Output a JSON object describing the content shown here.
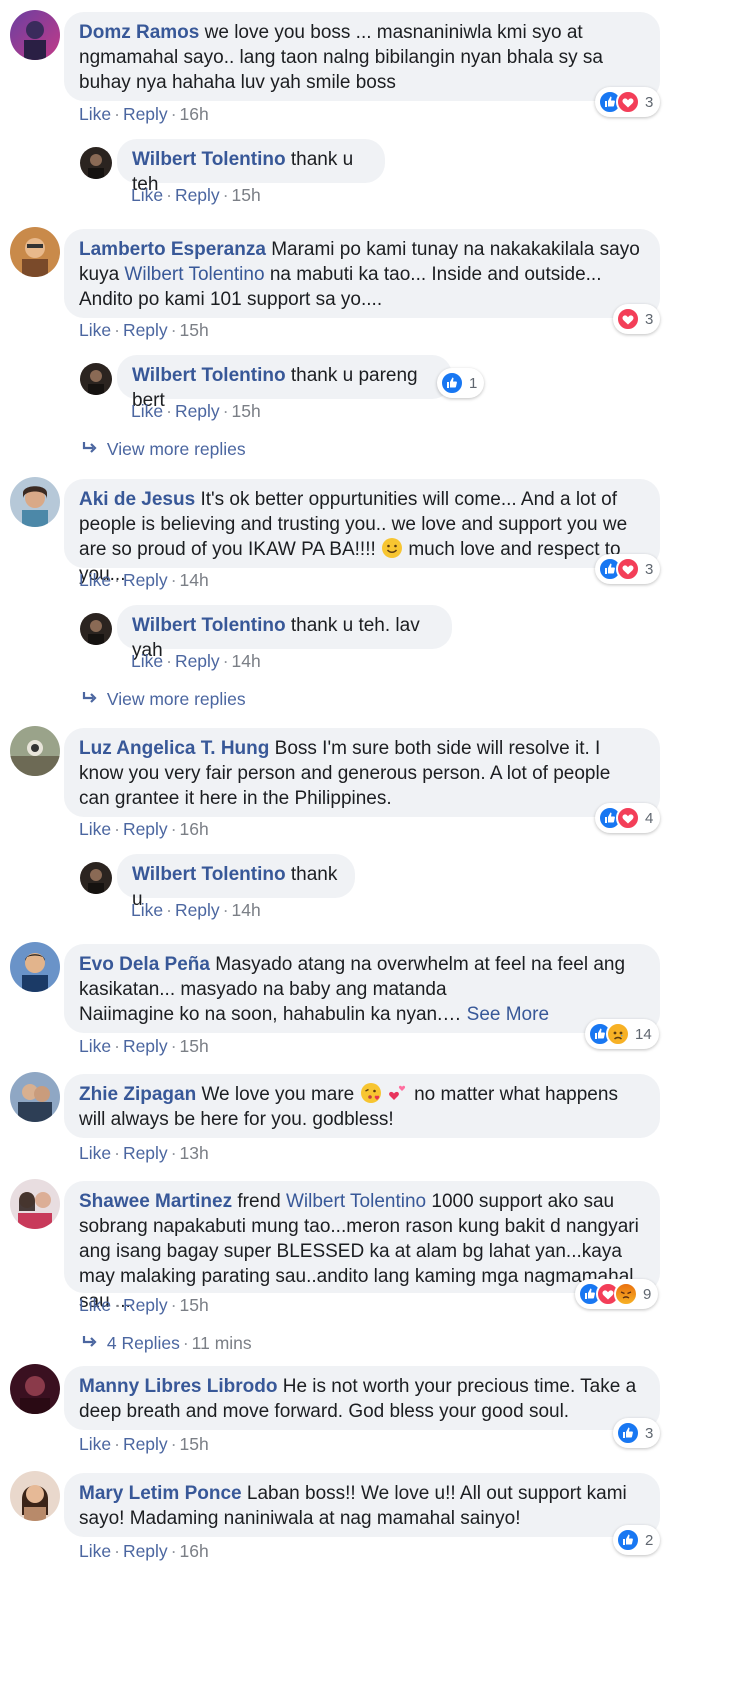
{
  "actions": {
    "like": "Like",
    "reply": "Reply",
    "sep": "·"
  },
  "colors": {
    "author": "#385898",
    "bubble": "#f0f2f5",
    "like_blue": "#1877f2",
    "love_red": "#f33e58",
    "emoji_yellow": "#f7b125"
  },
  "comments": [
    {
      "author": "Domz Ramos",
      "text": "we love you boss ... masnaniniwla kmi syo at ngmamahal sayo.. lang taon nalng bibilangin nyan bhala sy sa buhay nya hahaha luv yah smile boss",
      "time": "16h",
      "reactions": {
        "icons": [
          "like-icon",
          "love-icon"
        ],
        "count": "3"
      }
    },
    {
      "author": "Wilbert Tolentino",
      "text": "thank u teh",
      "time": "15h"
    },
    {
      "author": "Lamberto Esperanza",
      "text_pre": "Marami po kami tunay na nakakakilala sayo kuya",
      "mention": "Wilbert Tolentino",
      "text_post": "na mabuti ka tao... Inside and outside... Andito po kami 101 support sa yo....",
      "time": "15h",
      "reactions": {
        "icons": [
          "love-icon"
        ],
        "count": "3"
      }
    },
    {
      "author": "Wilbert Tolentino",
      "text": "thank u pareng bert",
      "time": "15h",
      "reactions": {
        "icons": [
          "like-icon"
        ],
        "count": "1"
      }
    },
    {
      "author": "Aki de Jesus",
      "text": "It's ok better oppurtunities will come... And a lot of people is believing and trusting you.. we love and support you we are so proud of you IKAW PA BA!!!!",
      "text_post": "much love and respect to you...",
      "time": "14h",
      "reactions": {
        "icons": [
          "like-icon",
          "love-icon"
        ],
        "count": "3"
      }
    },
    {
      "author": "Wilbert Tolentino",
      "text": "thank u teh. lav yah",
      "time": "14h"
    },
    {
      "author": "Luz Angelica T. Hung",
      "text": "Boss I'm sure both side will resolve it. I know you very fair person and generous person. A lot of people can grantee it here in the Philippines.",
      "time": "16h",
      "reactions": {
        "icons": [
          "like-icon",
          "love-icon"
        ],
        "count": "4"
      }
    },
    {
      "author": "Wilbert Tolentino",
      "text": "thank u",
      "time": "14h"
    },
    {
      "author": "Evo Dela Peña",
      "text": "Masyado atang na overwhelm at feel na feel ang kasikatan... masyado na baby ang matanda",
      "text_line3": "Naiimagine ko na soon, hahabulin ka nyan.…",
      "see_more": "See More",
      "time": "15h",
      "reactions": {
        "icons": [
          "like-icon",
          "sad-icon"
        ],
        "count": "14"
      }
    },
    {
      "author": "Zhie Zipagan",
      "text": "We love you mare",
      "text_post": "no matter what happens will always be here for you. godbless!",
      "time": "13h"
    },
    {
      "author": "Shawee Martinez",
      "text_pre": "frend",
      "mention": "Wilbert Tolentino",
      "text_post": "1000 support ako sau sobrang napakabuti mung tao...meron rason kung bakit d nangyari ang isang bagay super BLESSED ka at alam bg lahat yan...kaya may malaking parating sau..andito lang kaming mga nagmamahal sau ...",
      "time": "15h",
      "reactions": {
        "icons": [
          "like-icon",
          "love-icon",
          "angry-icon"
        ],
        "count": "9"
      }
    },
    {
      "author": "Manny Libres Librodo",
      "text": "He is not worth your precious time. Take a deep breath and move forward. God bless your good soul.",
      "time": "15h",
      "reactions": {
        "icons": [
          "like-icon"
        ],
        "count": "3"
      }
    },
    {
      "author": "Mary Letim Ponce",
      "text": "Laban boss!! We love u!! All out support kami sayo! Madaming naniniwala at nag mamahal sainyo!",
      "time": "16h",
      "reactions": {
        "icons": [
          "like-icon"
        ],
        "count": "2"
      }
    }
  ],
  "view_more": {
    "label": "View more replies"
  },
  "replies_link": {
    "label": "4 Replies",
    "time": "11 mins"
  }
}
